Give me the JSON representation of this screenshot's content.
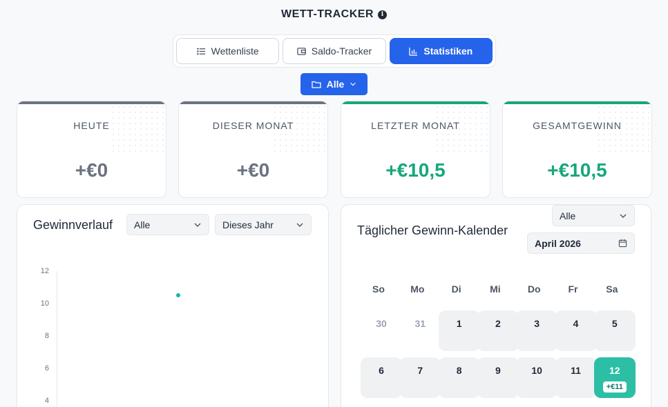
{
  "app": {
    "title": "WETT-TRACKER"
  },
  "tabs": [
    {
      "label": "Wettenliste",
      "icon": "list-icon",
      "active": false
    },
    {
      "label": "Saldo-Tracker",
      "icon": "wallet-icon",
      "active": false
    },
    {
      "label": "Statistiken",
      "icon": "bar-chart-icon",
      "active": true
    }
  ],
  "folder_filter": {
    "label": "Alle"
  },
  "stats": [
    {
      "label": "HEUTE",
      "value": "+€0",
      "color": "#6b7280"
    },
    {
      "label": "DIESER MONAT",
      "value": "+€0",
      "color": "#6b7280"
    },
    {
      "label": "LETZTER MONAT",
      "value": "+€10,5",
      "color": "#16a77a"
    },
    {
      "label": "GESAMTGEWINN",
      "value": "+€10,5",
      "color": "#16a77a"
    }
  ],
  "gewinnverlauf": {
    "title": "Gewinnverlauf",
    "filter_category": "Alle",
    "filter_period": "Dieses Jahr",
    "chart_data": {
      "type": "scatter",
      "y_ticks": [
        "12",
        "10",
        "8",
        "6",
        "4"
      ],
      "ylim": [
        0,
        12
      ],
      "points": [
        {
          "x": 1,
          "y": 10.5
        }
      ]
    }
  },
  "calendar": {
    "title": "Täglicher Gewinn-Kalender",
    "filter_category": "Alle",
    "month": "April 2026",
    "weekdays": [
      "So",
      "Mo",
      "Di",
      "Mi",
      "Do",
      "Fr",
      "Sa"
    ],
    "weeks": [
      [
        {
          "day": "30",
          "muted": true
        },
        {
          "day": "31",
          "muted": true
        },
        {
          "day": "1"
        },
        {
          "day": "2"
        },
        {
          "day": "3"
        },
        {
          "day": "4"
        },
        {
          "day": "5"
        }
      ],
      [
        {
          "day": "6"
        },
        {
          "day": "7"
        },
        {
          "day": "8"
        },
        {
          "day": "9"
        },
        {
          "day": "10"
        },
        {
          "day": "11"
        },
        {
          "day": "12",
          "win": true,
          "amount": "+€11"
        }
      ]
    ]
  }
}
